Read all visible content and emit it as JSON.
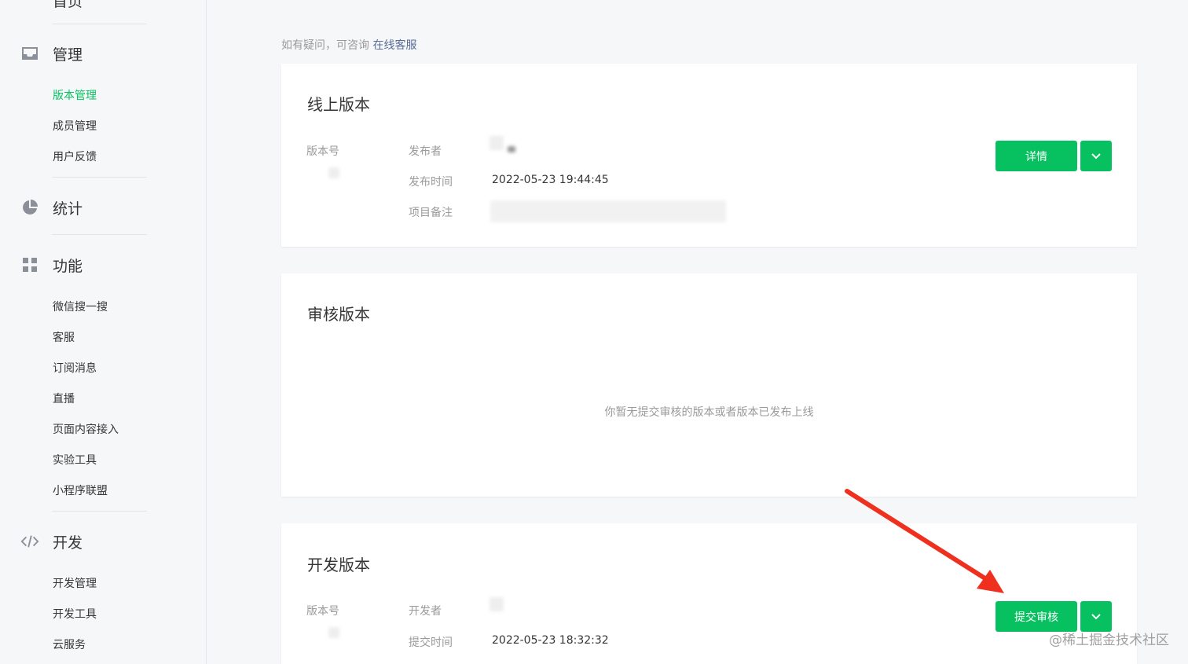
{
  "sidebar": {
    "top_partial_label": "首页",
    "sections": [
      {
        "title": "管理",
        "icon": "inbox-icon",
        "items": [
          "版本管理",
          "成员管理",
          "用户反馈"
        ]
      },
      {
        "title": "统计",
        "icon": "pie-chart-icon",
        "items": []
      },
      {
        "title": "功能",
        "icon": "grid-icon",
        "items": [
          "微信搜一搜",
          "客服",
          "订阅消息",
          "直播",
          "页面内容接入",
          "实验工具",
          "小程序联盟"
        ]
      },
      {
        "title": "开发",
        "icon": "code-icon",
        "items": [
          "开发管理",
          "开发工具",
          "云服务"
        ]
      }
    ],
    "active_item": "版本管理"
  },
  "main": {
    "note_prefix": "如有疑问，可咨询",
    "note_link": "在线客服",
    "online": {
      "title": "线上版本",
      "version_label": "版本号",
      "publisher_label": "发布者",
      "publish_time_label": "发布时间",
      "publish_time_value": "2022-05-23 19:44:45",
      "remark_label": "项目备注",
      "detail_button": "详情"
    },
    "review": {
      "title": "审核版本",
      "empty_message": "你暂无提交审核的版本或者版本已发布上线"
    },
    "dev": {
      "title": "开发版本",
      "version_label": "版本号",
      "developer_label": "开发者",
      "submit_time_label": "提交时间",
      "submit_time_value": "2022-05-23 18:32:32",
      "submit_button": "提交审核"
    }
  },
  "watermark": "@稀土掘金技术社区",
  "colors": {
    "accent": "#07c160",
    "link": "#576b95",
    "arrow": "#f0301e"
  }
}
